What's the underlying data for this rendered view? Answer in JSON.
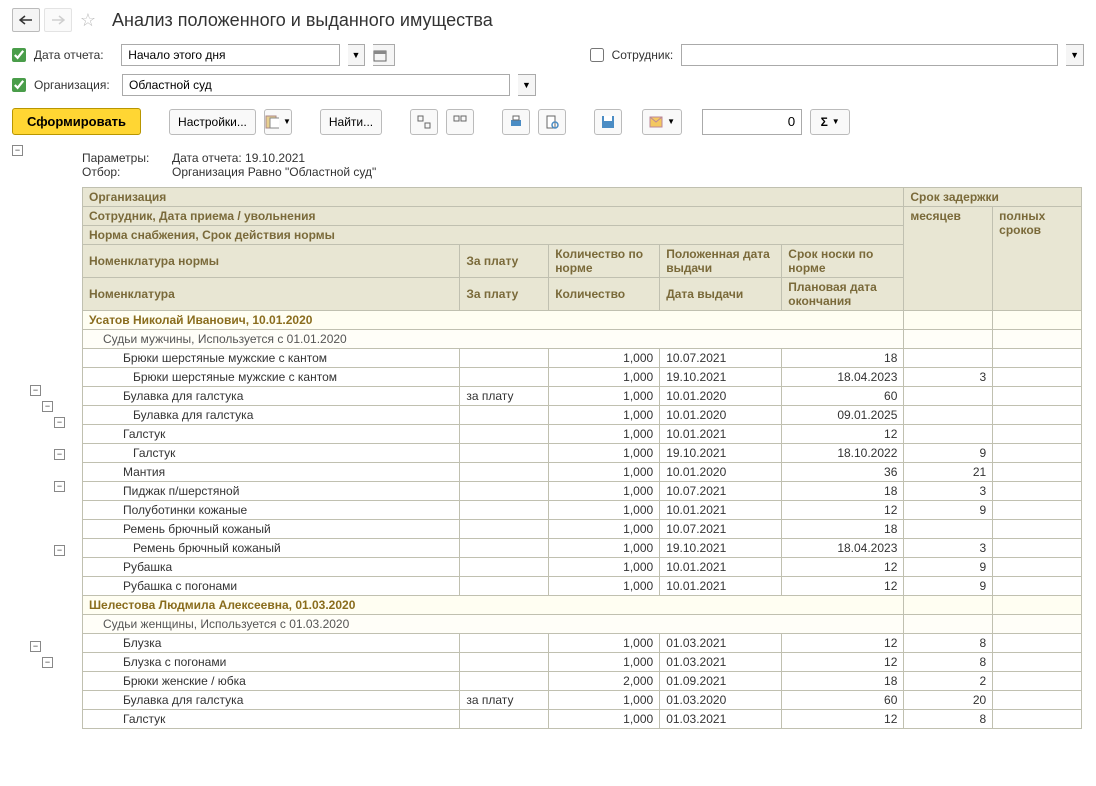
{
  "title": "Анализ положенного и выданного имущества",
  "params": {
    "date_label": "Дата отчета:",
    "date_value": "Начало этого дня",
    "employee_label": "Сотрудник:",
    "employee_value": "",
    "org_label": "Организация:",
    "org_value": "Областной суд"
  },
  "toolbar": {
    "generate": "Сформировать",
    "settings": "Настройки...",
    "find": "Найти...",
    "num_value": "0"
  },
  "report_params": {
    "label1": "Параметры:",
    "value1": "Дата отчета: 19.10.2021",
    "label2": "Отбор:",
    "value2": "Организация Равно \"Областной суд\""
  },
  "headers": {
    "org": "Организация",
    "delay": "Срок задержки",
    "emp": "Сотрудник, Дата приема / увольнения",
    "months": "месяцев",
    "full": "полных сроков",
    "norm": "Норма снабжения, Срок действия нормы",
    "nomen_norm": "Номенклатура нормы",
    "pay1": "За плату",
    "qty_norm": "Количество по норме",
    "date_due": "Положенная дата выдачи",
    "wear": "Срок носки по норме",
    "nomen": "Номенклатура",
    "pay2": "За плату",
    "qty": "Количество",
    "date_issue": "Дата выдачи",
    "date_plan": "Плановая дата окончания"
  },
  "rows": [
    {
      "t": "emp",
      "c0": "Усатов Николай Иванович, 10.01.2020"
    },
    {
      "t": "norm",
      "c0": "Судьи мужчины, Используется с 01.01.2020"
    },
    {
      "t": "data",
      "c0": "Брюки шерстяные мужские с кантом",
      "c1": "",
      "c2": "1,000",
      "c3": "10.07.2021",
      "c4": "18",
      "c5": "",
      "c6": ""
    },
    {
      "t": "sub",
      "c0": "Брюки шерстяные мужские с кантом",
      "c1": "",
      "c2": "1,000",
      "c3": "19.10.2021",
      "c4": "18.04.2023",
      "c5": "3",
      "c6": ""
    },
    {
      "t": "data",
      "c0": "Булавка для галстука",
      "c1": "за плату",
      "c2": "1,000",
      "c3": "10.01.2020",
      "c4": "60",
      "c5": "",
      "c6": ""
    },
    {
      "t": "sub",
      "c0": "Булавка для галстука",
      "c1": "",
      "c2": "1,000",
      "c3": "10.01.2020",
      "c4": "09.01.2025",
      "c5": "",
      "c6": ""
    },
    {
      "t": "data",
      "c0": "Галстук",
      "c1": "",
      "c2": "1,000",
      "c3": "10.01.2021",
      "c4": "12",
      "c5": "",
      "c6": ""
    },
    {
      "t": "sub",
      "c0": "Галстук",
      "c1": "",
      "c2": "1,000",
      "c3": "19.10.2021",
      "c4": "18.10.2022",
      "c5": "9",
      "c6": ""
    },
    {
      "t": "data",
      "c0": "Мантия",
      "c1": "",
      "c2": "1,000",
      "c3": "10.01.2020",
      "c4": "36",
      "c5": "21",
      "c6": ""
    },
    {
      "t": "data",
      "c0": "Пиджак п/шерстяной",
      "c1": "",
      "c2": "1,000",
      "c3": "10.07.2021",
      "c4": "18",
      "c5": "3",
      "c6": ""
    },
    {
      "t": "data",
      "c0": "Полуботинки кожаные",
      "c1": "",
      "c2": "1,000",
      "c3": "10.01.2021",
      "c4": "12",
      "c5": "9",
      "c6": ""
    },
    {
      "t": "data",
      "c0": "Ремень брючный кожаный",
      "c1": "",
      "c2": "1,000",
      "c3": "10.07.2021",
      "c4": "18",
      "c5": "",
      "c6": ""
    },
    {
      "t": "sub",
      "c0": "Ремень брючный кожаный",
      "c1": "",
      "c2": "1,000",
      "c3": "19.10.2021",
      "c4": "18.04.2023",
      "c5": "3",
      "c6": ""
    },
    {
      "t": "data",
      "c0": "Рубашка",
      "c1": "",
      "c2": "1,000",
      "c3": "10.01.2021",
      "c4": "12",
      "c5": "9",
      "c6": ""
    },
    {
      "t": "data",
      "c0": "Рубашка с погонами",
      "c1": "",
      "c2": "1,000",
      "c3": "10.01.2021",
      "c4": "12",
      "c5": "9",
      "c6": ""
    },
    {
      "t": "emp",
      "c0": "Шелестова Людмила Алексеевна, 01.03.2020"
    },
    {
      "t": "norm",
      "c0": "Судьи женщины, Используется с 01.03.2020"
    },
    {
      "t": "data",
      "c0": "Блузка",
      "c1": "",
      "c2": "1,000",
      "c3": "01.03.2021",
      "c4": "12",
      "c5": "8",
      "c6": ""
    },
    {
      "t": "data",
      "c0": "Блузка с погонами",
      "c1": "",
      "c2": "1,000",
      "c3": "01.03.2021",
      "c4": "12",
      "c5": "8",
      "c6": ""
    },
    {
      "t": "data",
      "c0": "Брюки женские / юбка",
      "c1": "",
      "c2": "2,000",
      "c3": "01.09.2021",
      "c4": "18",
      "c5": "2",
      "c6": ""
    },
    {
      "t": "data",
      "c0": "Булавка для галстука",
      "c1": "за плату",
      "c2": "1,000",
      "c3": "01.03.2020",
      "c4": "60",
      "c5": "20",
      "c6": ""
    },
    {
      "t": "data",
      "c0": "Галстук",
      "c1": "",
      "c2": "1,000",
      "c3": "01.03.2021",
      "c4": "12",
      "c5": "8",
      "c6": ""
    }
  ]
}
